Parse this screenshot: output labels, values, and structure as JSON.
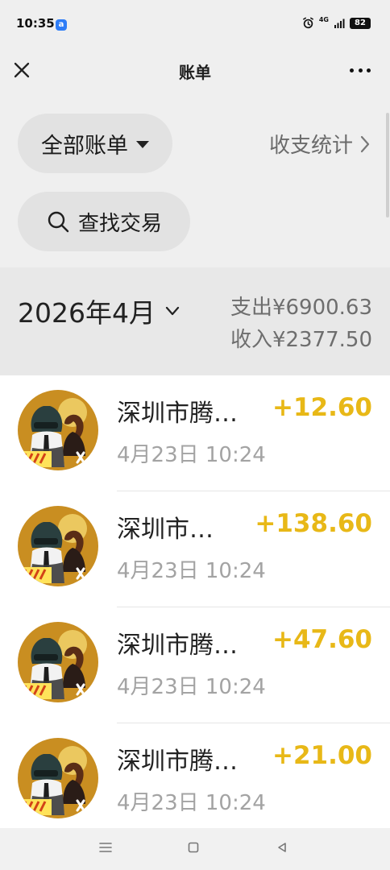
{
  "status_bar": {
    "time": "10:35",
    "app_badge": "a",
    "network_label": "4G",
    "battery": "82"
  },
  "header": {
    "title": "账单"
  },
  "filters": {
    "all_bills_label": "全部账单",
    "stats_label": "收支统计",
    "search_label": "查找交易"
  },
  "month_summary": {
    "month_label": "2026年4月",
    "expense_text": "支出¥6900.63",
    "income_text": "收入¥2377.50"
  },
  "transactions": [
    {
      "name": "深圳市腾…",
      "time": "4月23日 10:24",
      "amount": "+12.60"
    },
    {
      "name": "深圳市…",
      "time": "4月23日 10:24",
      "amount": "+138.60"
    },
    {
      "name": "深圳市腾…",
      "time": "4月23日 10:24",
      "amount": "+47.60"
    },
    {
      "name": "深圳市腾…",
      "time": "4月23日 10:24",
      "amount": "+21.00"
    }
  ],
  "colors": {
    "background": "#efefef",
    "accent_amount": "#e8b817",
    "muted_text": "#a3a3a3"
  },
  "icons": {
    "close": "close-icon",
    "more": "more-icon",
    "dropdown": "caret-down-icon",
    "stats_arrow": "chevron-right-icon",
    "search": "search-icon",
    "month_toggle": "chevron-down-icon"
  }
}
